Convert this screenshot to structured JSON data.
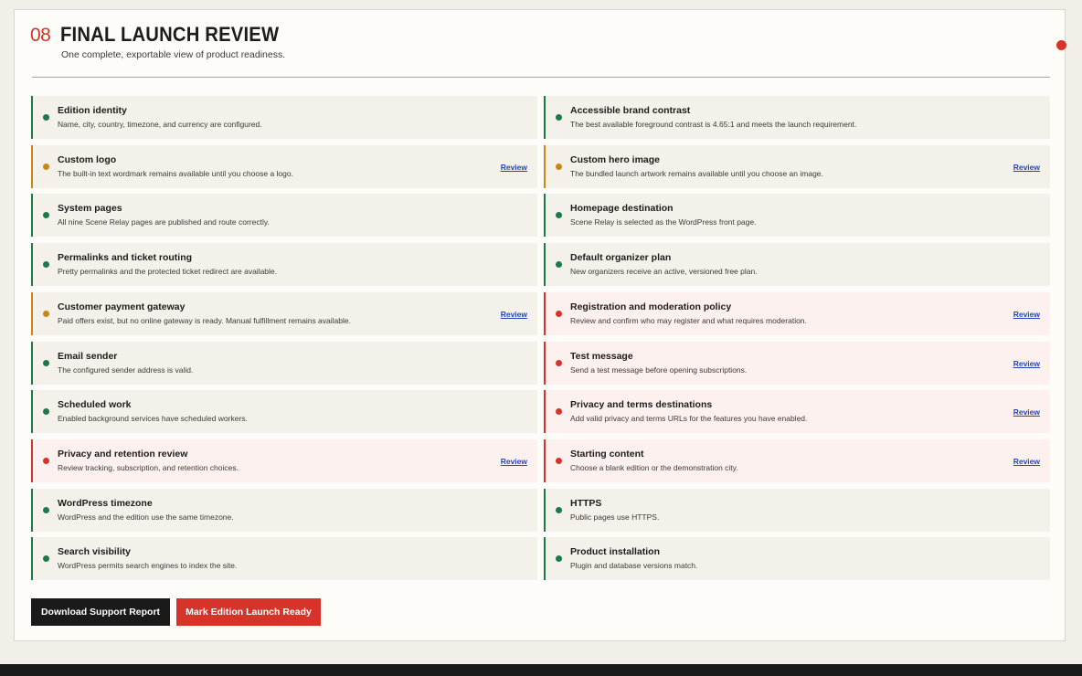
{
  "header": {
    "step": "08",
    "title": "FINAL LAUNCH REVIEW",
    "subtitle": "One complete, exportable view of product readiness."
  },
  "colors": {
    "ok": "#1c7a48",
    "warn": "#c98816",
    "crit": "#d6332b",
    "accent": "#d6332b",
    "link": "#2447b7"
  },
  "review_label": "Review",
  "left_items": [
    {
      "title": "Edition identity",
      "desc": "Name, city, country, timezone, and currency are configured.",
      "status": "ok"
    },
    {
      "title": "Custom logo",
      "desc": "The built-in text wordmark remains available until you choose a logo.",
      "status": "warn",
      "review": "Review"
    },
    {
      "title": "System pages",
      "desc": "All nine Scene Relay pages are published and route correctly.",
      "status": "ok"
    },
    {
      "title": "Permalinks and ticket routing",
      "desc": "Pretty permalinks and the protected ticket redirect are available.",
      "status": "ok"
    },
    {
      "title": "Customer payment gateway",
      "desc": "Paid offers exist, but no online gateway is ready. Manual fulfillment remains available.",
      "status": "warn",
      "review": "Review"
    },
    {
      "title": "Email sender",
      "desc": "The configured sender address is valid.",
      "status": "ok"
    },
    {
      "title": "Scheduled work",
      "desc": "Enabled background services have scheduled workers.",
      "status": "ok"
    },
    {
      "title": "Privacy and retention review",
      "desc": "Review tracking, subscription, and retention choices.",
      "status": "crit",
      "review": "Review"
    },
    {
      "title": "WordPress timezone",
      "desc": "WordPress and the edition use the same timezone.",
      "status": "ok"
    },
    {
      "title": "Search visibility",
      "desc": "WordPress permits search engines to index the site.",
      "status": "ok"
    }
  ],
  "right_items": [
    {
      "title": "Accessible brand contrast",
      "desc": "The best available foreground contrast is 4.65:1 and meets the launch requirement.",
      "status": "ok"
    },
    {
      "title": "Custom hero image",
      "desc": "The bundled launch artwork remains available until you choose an image.",
      "status": "warn",
      "review": "Review"
    },
    {
      "title": "Homepage destination",
      "desc": "Scene Relay is selected as the WordPress front page.",
      "status": "ok"
    },
    {
      "title": "Default organizer plan",
      "desc": "New organizers receive an active, versioned free plan.",
      "status": "ok"
    },
    {
      "title": "Registration and moderation policy",
      "desc": "Review and confirm who may register and what requires moderation.",
      "status": "crit",
      "review": "Review"
    },
    {
      "title": "Test message",
      "desc": "Send a test message before opening subscriptions.",
      "status": "crit",
      "review": "Review"
    },
    {
      "title": "Privacy and terms destinations",
      "desc": "Add valid privacy and terms URLs for the features you have enabled.",
      "status": "crit",
      "review": "Review"
    },
    {
      "title": "Starting content",
      "desc": "Choose a blank edition or the demonstration city.",
      "status": "crit",
      "review": "Review"
    },
    {
      "title": "HTTPS",
      "desc": "Public pages use HTTPS.",
      "status": "ok"
    },
    {
      "title": "Product installation",
      "desc": "Plugin and database versions match.",
      "status": "ok"
    }
  ],
  "actions": {
    "download_label": "Download Support Report",
    "launch_label": "Mark Edition Launch Ready"
  }
}
